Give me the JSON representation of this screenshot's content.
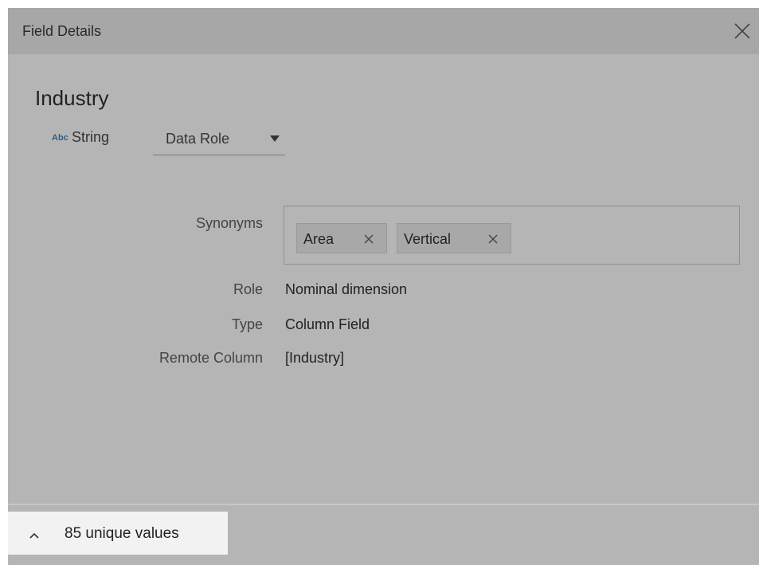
{
  "dialog": {
    "title": "Field Details"
  },
  "field": {
    "name": "Industry",
    "type_icon_text": "Abc",
    "type_label": "String",
    "data_role_label": "Data Role"
  },
  "details": {
    "synonyms_label": "Synonyms",
    "synonyms": [
      "Area",
      "Vertical"
    ],
    "role_label": "Role",
    "role_value": "Nominal dimension",
    "type_label": "Type",
    "type_value": "Column Field",
    "remote_column_label": "Remote Column",
    "remote_column_value": "[Industry]"
  },
  "footer": {
    "unique_values_label": "85 unique values"
  },
  "icons": {
    "close": "close-icon",
    "dropdown": "caret-down-icon",
    "chip_remove": "close-icon",
    "expand": "chevron-up-icon"
  },
  "colors": {
    "dialog_background": "#b5b5b5",
    "title_bar_background": "#a7a7a7",
    "chip_background": "#a8a8a8",
    "footer_highlight": "#f2f2f2",
    "type_icon_color": "#2e5f8a"
  }
}
